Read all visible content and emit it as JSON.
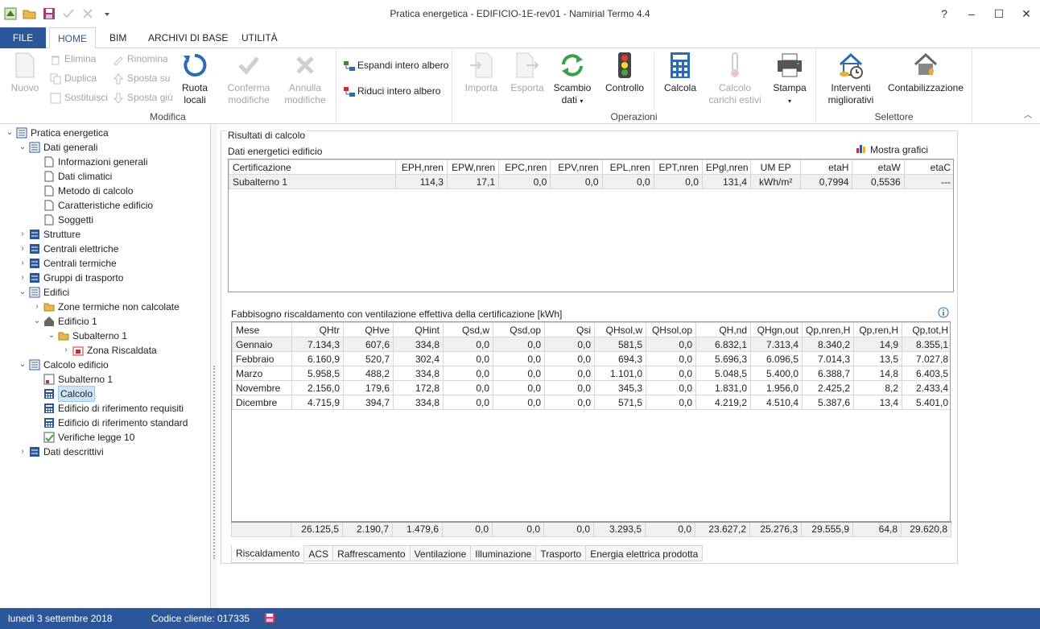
{
  "window": {
    "title": "Pratica energetica - EDIFICIO-1E-rev01 - Namirial Termo 4.4",
    "help": "?",
    "minimize": "–",
    "maximize": "☐",
    "close": "✕"
  },
  "menu": {
    "file": "FILE",
    "home": "HOME",
    "bim": "BIM",
    "archivi": "ARCHIVI DI BASE",
    "utilita": "UTILITÀ"
  },
  "ribbon": {
    "modifica": {
      "label": "Modifica",
      "nuovo": "Nuovo",
      "elimina": "Elimina",
      "duplica": "Duplica",
      "sostituisci": "Sostituisci",
      "rinomina": "Rinomina",
      "sposta_su": "Sposta su",
      "sposta_giu": "Sposta giù",
      "ruota_1": "Ruota",
      "ruota_2": "locali",
      "conferma_1": "Conferma",
      "conferma_2": "modifiche",
      "annulla_1": "Annulla",
      "annulla_2": "modifiche"
    },
    "albero": {
      "espandi": "Espandi intero albero",
      "riduci": "Riduci intero albero"
    },
    "operazioni": {
      "label": "Operazioni",
      "importa": "Importa",
      "esporta": "Esporta",
      "scambio_1": "Scambio",
      "scambio_2": "dati",
      "controllo": "Controllo",
      "calcola": "Calcola",
      "carichi_1": "Calcolo",
      "carichi_2": "carichi estivi",
      "stampa": "Stampa"
    },
    "selettore": {
      "label": "Selettore",
      "interventi_1": "Interventi",
      "interventi_2": "migliorativi",
      "contabilizzazione": "Contabilizzazione"
    }
  },
  "tree": {
    "root": "Pratica energetica",
    "dati_generali": "Dati generali",
    "informazioni": "Informazioni generali",
    "dati_climatici": "Dati climatici",
    "metodo": "Metodo di calcolo",
    "caratteristiche": "Caratteristiche edificio",
    "soggetti": "Soggetti",
    "strutture": "Strutture",
    "centrali_elettriche": "Centrali elettriche",
    "centrali_termiche": "Centrali termiche",
    "gruppi": "Gruppi di trasporto",
    "edifici": "Edifici",
    "zone_non_calc": "Zone termiche non calcolate",
    "edificio1": "Edificio 1",
    "subalterno1": "Subalterno 1",
    "zona_risc": "Zona Riscaldata",
    "calcolo_edificio": "Calcolo edificio",
    "calc_subalterno": "Subalterno 1",
    "calcolo": "Calcolo",
    "rif_requisiti": "Edificio di riferimento requisiti",
    "rif_standard": "Edificio di riferimento standard",
    "verifiche": "Verifiche legge 10",
    "dati_descrittivi": "Dati descrittivi"
  },
  "results": {
    "legend": "Risultati di calcolo",
    "section1": "Dati energetici edificio",
    "mostra_grafici": "Mostra grafici",
    "cert_headers": [
      "Certificazione",
      "EPH,nren",
      "EPW,nren",
      "EPC,nren",
      "EPV,nren",
      "EPL,nren",
      "EPT,nren",
      "EPgl,nren",
      "UM EP",
      "etaH",
      "etaW",
      "etaC"
    ],
    "cert_rows": [
      [
        "Subalterno 1",
        "114,3",
        "17,1",
        "0,0",
        "0,0",
        "0,0",
        "0,0",
        "131,4",
        "kWh/m²",
        "0,7994",
        "0,5536",
        "---"
      ]
    ],
    "section2": "Fabbisogno riscaldamento con ventilazione effettiva della certificazione [kWh]",
    "fabb_headers": [
      "Mese",
      "QHtr",
      "QHve",
      "QHint",
      "Qsd,w",
      "Qsd,op",
      "Qsi",
      "QHsol,w",
      "QHsol,op",
      "QH,nd",
      "QHgn,out",
      "Qp,nren,H",
      "Qp,ren,H",
      "Qp,tot,H"
    ],
    "fabb_rows": [
      [
        "Gennaio",
        "7.134,3",
        "607,6",
        "334,8",
        "0,0",
        "0,0",
        "0,0",
        "581,5",
        "0,0",
        "6.832,1",
        "7.313,4",
        "8.340,2",
        "14,9",
        "8.355,1"
      ],
      [
        "Febbraio",
        "6.160,9",
        "520,7",
        "302,4",
        "0,0",
        "0,0",
        "0,0",
        "694,3",
        "0,0",
        "5.696,3",
        "6.096,5",
        "7.014,3",
        "13,5",
        "7.027,8"
      ],
      [
        "Marzo",
        "5.958,5",
        "488,2",
        "334,8",
        "0,0",
        "0,0",
        "0,0",
        "1.101,0",
        "0,0",
        "5.048,5",
        "5.400,0",
        "6.388,7",
        "14,8",
        "6.403,5"
      ],
      [
        "Novembre",
        "2.156,0",
        "179,6",
        "172,8",
        "0,0",
        "0,0",
        "0,0",
        "345,3",
        "0,0",
        "1.831,0",
        "1.956,0",
        "2.425,2",
        "8,2",
        "2.433,4"
      ],
      [
        "Dicembre",
        "4.715,9",
        "394,7",
        "334,8",
        "0,0",
        "0,0",
        "0,0",
        "571,5",
        "0,0",
        "4.219,2",
        "4.510,4",
        "5.387,6",
        "13,4",
        "5.401,0"
      ]
    ],
    "fabb_totals": [
      "",
      "26.125,5",
      "2.190,7",
      "1.479,6",
      "0,0",
      "0,0",
      "0,0",
      "3.293,5",
      "0,0",
      "23.627,2",
      "25.276,3",
      "29.555,9",
      "64,8",
      "29.620,8"
    ],
    "tabs": [
      "Riscaldamento",
      "ACS",
      "Raffrescamento",
      "Ventilazione",
      "Illuminazione",
      "Trasporto",
      "Energia elettrica prodotta"
    ]
  },
  "status": {
    "date": "lunedì 3 settembre 2018",
    "client": "Codice cliente: 017335"
  },
  "colors": {
    "accent": "#2b579a",
    "selection": "#cce4f7"
  }
}
